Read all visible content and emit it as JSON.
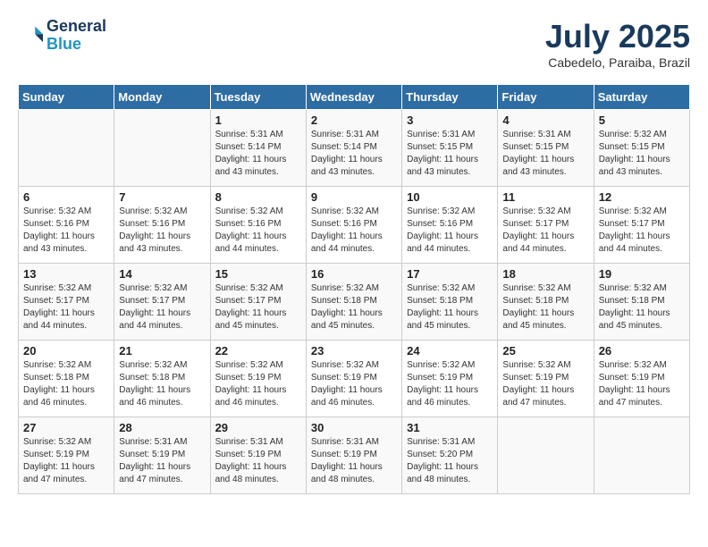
{
  "logo": {
    "line1": "General",
    "line2": "Blue"
  },
  "title": "July 2025",
  "subtitle": "Cabedelo, Paraiba, Brazil",
  "days_of_week": [
    "Sunday",
    "Monday",
    "Tuesday",
    "Wednesday",
    "Thursday",
    "Friday",
    "Saturday"
  ],
  "weeks": [
    [
      {
        "day": "",
        "info": ""
      },
      {
        "day": "",
        "info": ""
      },
      {
        "day": "1",
        "sunrise": "Sunrise: 5:31 AM",
        "sunset": "Sunset: 5:14 PM",
        "daylight": "Daylight: 11 hours and 43 minutes."
      },
      {
        "day": "2",
        "sunrise": "Sunrise: 5:31 AM",
        "sunset": "Sunset: 5:14 PM",
        "daylight": "Daylight: 11 hours and 43 minutes."
      },
      {
        "day": "3",
        "sunrise": "Sunrise: 5:31 AM",
        "sunset": "Sunset: 5:15 PM",
        "daylight": "Daylight: 11 hours and 43 minutes."
      },
      {
        "day": "4",
        "sunrise": "Sunrise: 5:31 AM",
        "sunset": "Sunset: 5:15 PM",
        "daylight": "Daylight: 11 hours and 43 minutes."
      },
      {
        "day": "5",
        "sunrise": "Sunrise: 5:32 AM",
        "sunset": "Sunset: 5:15 PM",
        "daylight": "Daylight: 11 hours and 43 minutes."
      }
    ],
    [
      {
        "day": "6",
        "sunrise": "Sunrise: 5:32 AM",
        "sunset": "Sunset: 5:16 PM",
        "daylight": "Daylight: 11 hours and 43 minutes."
      },
      {
        "day": "7",
        "sunrise": "Sunrise: 5:32 AM",
        "sunset": "Sunset: 5:16 PM",
        "daylight": "Daylight: 11 hours and 43 minutes."
      },
      {
        "day": "8",
        "sunrise": "Sunrise: 5:32 AM",
        "sunset": "Sunset: 5:16 PM",
        "daylight": "Daylight: 11 hours and 44 minutes."
      },
      {
        "day": "9",
        "sunrise": "Sunrise: 5:32 AM",
        "sunset": "Sunset: 5:16 PM",
        "daylight": "Daylight: 11 hours and 44 minutes."
      },
      {
        "day": "10",
        "sunrise": "Sunrise: 5:32 AM",
        "sunset": "Sunset: 5:16 PM",
        "daylight": "Daylight: 11 hours and 44 minutes."
      },
      {
        "day": "11",
        "sunrise": "Sunrise: 5:32 AM",
        "sunset": "Sunset: 5:17 PM",
        "daylight": "Daylight: 11 hours and 44 minutes."
      },
      {
        "day": "12",
        "sunrise": "Sunrise: 5:32 AM",
        "sunset": "Sunset: 5:17 PM",
        "daylight": "Daylight: 11 hours and 44 minutes."
      }
    ],
    [
      {
        "day": "13",
        "sunrise": "Sunrise: 5:32 AM",
        "sunset": "Sunset: 5:17 PM",
        "daylight": "Daylight: 11 hours and 44 minutes."
      },
      {
        "day": "14",
        "sunrise": "Sunrise: 5:32 AM",
        "sunset": "Sunset: 5:17 PM",
        "daylight": "Daylight: 11 hours and 44 minutes."
      },
      {
        "day": "15",
        "sunrise": "Sunrise: 5:32 AM",
        "sunset": "Sunset: 5:17 PM",
        "daylight": "Daylight: 11 hours and 45 minutes."
      },
      {
        "day": "16",
        "sunrise": "Sunrise: 5:32 AM",
        "sunset": "Sunset: 5:18 PM",
        "daylight": "Daylight: 11 hours and 45 minutes."
      },
      {
        "day": "17",
        "sunrise": "Sunrise: 5:32 AM",
        "sunset": "Sunset: 5:18 PM",
        "daylight": "Daylight: 11 hours and 45 minutes."
      },
      {
        "day": "18",
        "sunrise": "Sunrise: 5:32 AM",
        "sunset": "Sunset: 5:18 PM",
        "daylight": "Daylight: 11 hours and 45 minutes."
      },
      {
        "day": "19",
        "sunrise": "Sunrise: 5:32 AM",
        "sunset": "Sunset: 5:18 PM",
        "daylight": "Daylight: 11 hours and 45 minutes."
      }
    ],
    [
      {
        "day": "20",
        "sunrise": "Sunrise: 5:32 AM",
        "sunset": "Sunset: 5:18 PM",
        "daylight": "Daylight: 11 hours and 46 minutes."
      },
      {
        "day": "21",
        "sunrise": "Sunrise: 5:32 AM",
        "sunset": "Sunset: 5:18 PM",
        "daylight": "Daylight: 11 hours and 46 minutes."
      },
      {
        "day": "22",
        "sunrise": "Sunrise: 5:32 AM",
        "sunset": "Sunset: 5:19 PM",
        "daylight": "Daylight: 11 hours and 46 minutes."
      },
      {
        "day": "23",
        "sunrise": "Sunrise: 5:32 AM",
        "sunset": "Sunset: 5:19 PM",
        "daylight": "Daylight: 11 hours and 46 minutes."
      },
      {
        "day": "24",
        "sunrise": "Sunrise: 5:32 AM",
        "sunset": "Sunset: 5:19 PM",
        "daylight": "Daylight: 11 hours and 46 minutes."
      },
      {
        "day": "25",
        "sunrise": "Sunrise: 5:32 AM",
        "sunset": "Sunset: 5:19 PM",
        "daylight": "Daylight: 11 hours and 47 minutes."
      },
      {
        "day": "26",
        "sunrise": "Sunrise: 5:32 AM",
        "sunset": "Sunset: 5:19 PM",
        "daylight": "Daylight: 11 hours and 47 minutes."
      }
    ],
    [
      {
        "day": "27",
        "sunrise": "Sunrise: 5:32 AM",
        "sunset": "Sunset: 5:19 PM",
        "daylight": "Daylight: 11 hours and 47 minutes."
      },
      {
        "day": "28",
        "sunrise": "Sunrise: 5:31 AM",
        "sunset": "Sunset: 5:19 PM",
        "daylight": "Daylight: 11 hours and 47 minutes."
      },
      {
        "day": "29",
        "sunrise": "Sunrise: 5:31 AM",
        "sunset": "Sunset: 5:19 PM",
        "daylight": "Daylight: 11 hours and 48 minutes."
      },
      {
        "day": "30",
        "sunrise": "Sunrise: 5:31 AM",
        "sunset": "Sunset: 5:19 PM",
        "daylight": "Daylight: 11 hours and 48 minutes."
      },
      {
        "day": "31",
        "sunrise": "Sunrise: 5:31 AM",
        "sunset": "Sunset: 5:20 PM",
        "daylight": "Daylight: 11 hours and 48 minutes."
      },
      {
        "day": "",
        "info": ""
      },
      {
        "day": "",
        "info": ""
      }
    ]
  ]
}
